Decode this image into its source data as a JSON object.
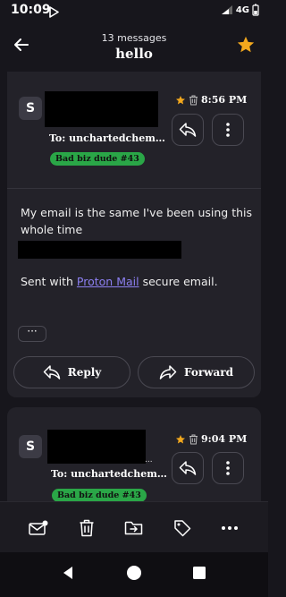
{
  "status_bar": {
    "time": "10:09",
    "network": "4G"
  },
  "header": {
    "message_count": "13 messages",
    "subject": "hello"
  },
  "messages": [
    {
      "sender_initial": "S",
      "to_line": "To: unchartedchem…",
      "label": "Bad biz dude #43",
      "time": "8:56 PM",
      "body_line1": "My email is the same I've been using this",
      "body_line2": "whole time",
      "signature_prefix": "Sent with ",
      "signature_link": "Proton Mail",
      "signature_suffix": " secure email.",
      "more_label": "···",
      "reply_label": "Reply",
      "forward_label": "Forward"
    },
    {
      "sender_initial": "S",
      "redacted_suffix": "...",
      "to_line": "To: unchartedchem…",
      "label": "Bad biz dude #43",
      "time": "9:04 PM"
    }
  ],
  "colors": {
    "star": "#f3a81d",
    "label_bg": "#2aa647",
    "link": "#8c7ff0",
    "background": "#17161c",
    "card": "#232229"
  },
  "icons": [
    "back-arrow-icon",
    "star-icon",
    "trash-icon",
    "reply-icon",
    "more-vert-icon",
    "forward-icon",
    "mark-unread-icon",
    "move-icon",
    "tag-icon",
    "more-horiz-icon"
  ]
}
